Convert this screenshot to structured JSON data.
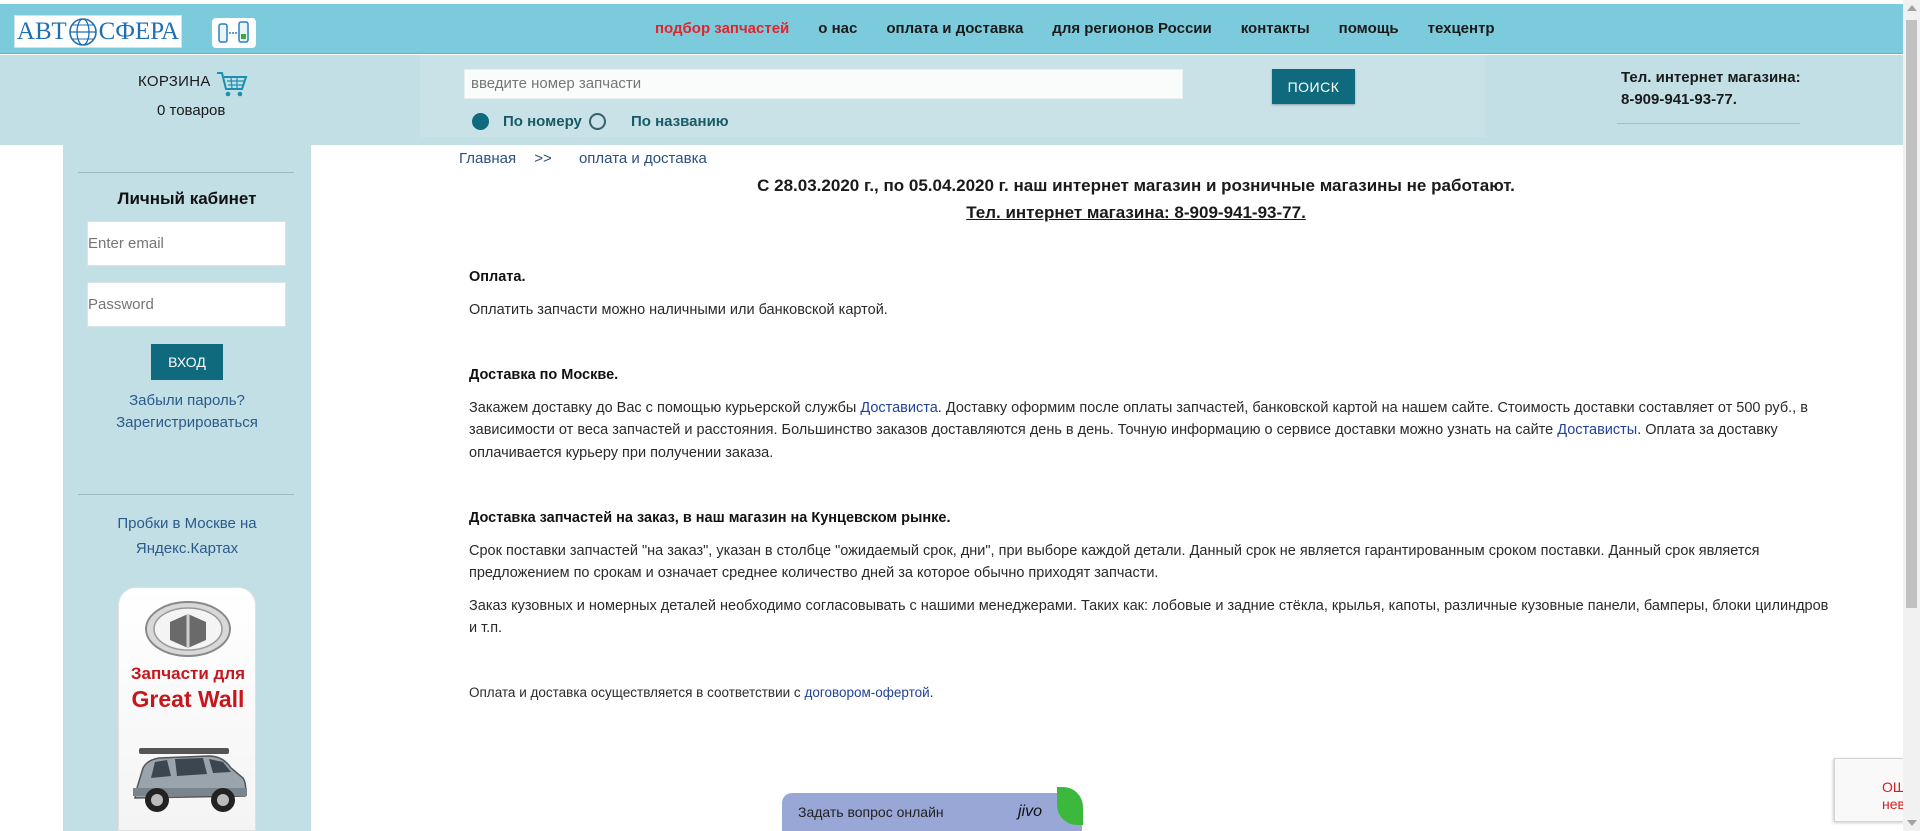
{
  "header": {
    "logo_left": "АВТ",
    "logo_right": "СФЕРА",
    "nav": [
      {
        "label": "подбор запчастей",
        "active": true
      },
      {
        "label": "о нас",
        "active": false
      },
      {
        "label": "оплата и доставка",
        "active": false
      },
      {
        "label": "для регионов России",
        "active": false
      },
      {
        "label": "контакты",
        "active": false
      },
      {
        "label": "помощь",
        "active": false
      },
      {
        "label": "техцентр",
        "active": false
      }
    ]
  },
  "cart": {
    "title": "КОРЗИНА",
    "count": "0 товаров"
  },
  "search": {
    "placeholder": "введите номер запчасти",
    "button": "ПОИСК",
    "radio_number": "По номеру",
    "radio_name": "По названию"
  },
  "phone_block": {
    "label": "Тел. интернет магазина:",
    "number": "8-909-941-93-77."
  },
  "sidebar": {
    "cabinet_title": "Личный кабинет",
    "email_placeholder": "Enter email",
    "password_placeholder": "Password",
    "login_button": "ВХОД",
    "forgot": "Забыли пароль?",
    "register": "Зарегистрироваться",
    "traffic_line1": "Пробки в Москве на",
    "traffic_line2": "Яндекс.Картах",
    "banner_line1": "Запчасти для",
    "banner_line2": "Great Wall"
  },
  "breadcrumb": {
    "home": "Главная",
    "sep": ">>",
    "current": "оплата и доставка"
  },
  "notice": {
    "line1": "С 28.03.2020 г., по 05.04.2020 г. наш интернет магазин и розничные магазины не работают.",
    "line2": "Тел. интернет магазина: 8-909-941-93-77."
  },
  "content": {
    "payment_title": "Оплата.",
    "payment_text": "Оплатить запчасти можно наличными или банковской картой.",
    "moscow_title": "Доставка по Москве.",
    "moscow_text_1": "Закажем доставку до Вас с помощью курьерской службы ",
    "moscow_link_1": "Достависта",
    "moscow_text_2": ". Доставку оформим после оплаты запчастей, банковской картой на нашем сайте. Стоимость доставки составляет от 500 руб., в зависимости от веса запчастей и расстояния. Большинство заказов доставляются день в день. Точную информацию о сервисе доставки можно узнать на сайте ",
    "moscow_link_2": "Достависты",
    "moscow_text_3": ". Оплата за доставку оплачивается курьеру при получении заказа.",
    "order_title": "Доставка запчастей на заказ, в наш магазин на Кунцевском рынке.",
    "order_text_1": "Срок поставки запчастей \"на заказ\", указан в столбце \"ожидаемый срок, дни\", при выборе каждой детали. Данный срок не является гарантированным сроком поставки. Данный срок является предложением по срокам и означает среднее количество дней за которое обычно приходят запчасти.",
    "order_text_2": "Заказ кузовных и номерных деталей необходимо согласовывать с нашими менеджерами. Таких как: лобовые и задние стёкла, крылья, капоты, различные кузовные панели, бамперы, блоки цилиндров и т.п.",
    "footer_text": "Оплата и доставка осуществляется в соответствии с ",
    "footer_link": "договором-офертой",
    "footer_end": "."
  },
  "widgets": {
    "jivo_label": "Задать вопрос онлайн",
    "jivo_brand": "jivo",
    "recaptcha_line1": "ОШИБКА",
    "recaptcha_line2": "неверны"
  },
  "colors": {
    "accent": "#0e6a7c",
    "topbar": "#7ccbdc",
    "panel": "#c2dfe6",
    "active_nav": "#e2242b"
  }
}
